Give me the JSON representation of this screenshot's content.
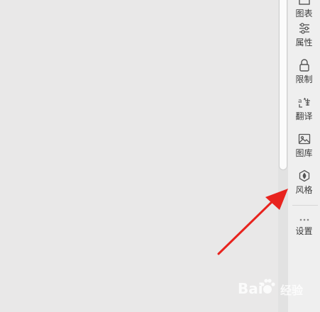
{
  "sidebar": {
    "items": [
      {
        "label": "图表",
        "icon": "chart-icon"
      },
      {
        "label": "属性",
        "icon": "sliders-icon"
      },
      {
        "label": "限制",
        "icon": "lock-icon"
      },
      {
        "label": "翻译",
        "icon": "translate-icon"
      },
      {
        "label": "图库",
        "icon": "image-icon"
      },
      {
        "label": "风格",
        "icon": "style-icon"
      },
      {
        "label": "设置",
        "icon": "more-dots-icon"
      }
    ]
  },
  "watermark": {
    "text": "Bai",
    "sub": "经验"
  },
  "colors": {
    "accent_arrow": "#e8231e",
    "background": "#e9e8e8",
    "sidebar": "#efefef"
  }
}
